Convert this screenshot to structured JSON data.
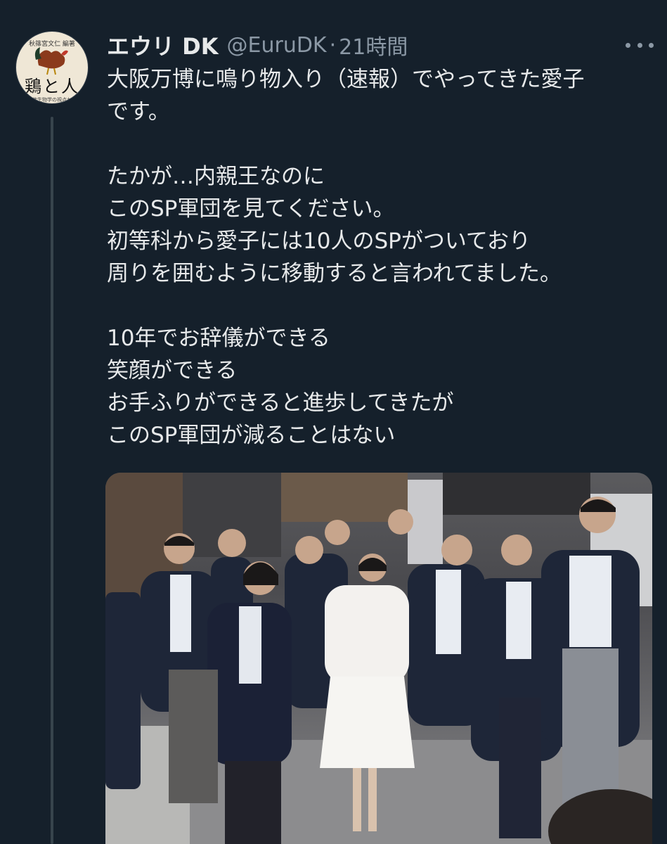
{
  "user": {
    "display_name": "エウリ DK",
    "handle": "@EuruDK",
    "separator": "·",
    "time": "21時間"
  },
  "avatar": {
    "top_text": "秋篠宮文仁 編著",
    "title": "鶏と人",
    "subtitle": "民族生物学の視点から"
  },
  "tweet": {
    "lines": [
      "大阪万博に鳴り物入り（速報）でやってきた愛子",
      "です。",
      "",
      "たかが…内親王なのに",
      "このSP軍団を見てください。",
      "初等科から愛子には10人のSPがついており",
      "周りを囲むように移動すると言われてました。",
      "",
      "10年でお辞儀ができる",
      "笑顔ができる",
      "お手ふりができると進歩してきたが",
      "このSP軍団が減ることはない"
    ]
  },
  "icons": {
    "more": "more-horizontal-icon"
  },
  "colors": {
    "background": "#15202b",
    "text": "#e7e9ea",
    "secondary_text": "#8b98a5",
    "thread_line": "#38444d"
  }
}
